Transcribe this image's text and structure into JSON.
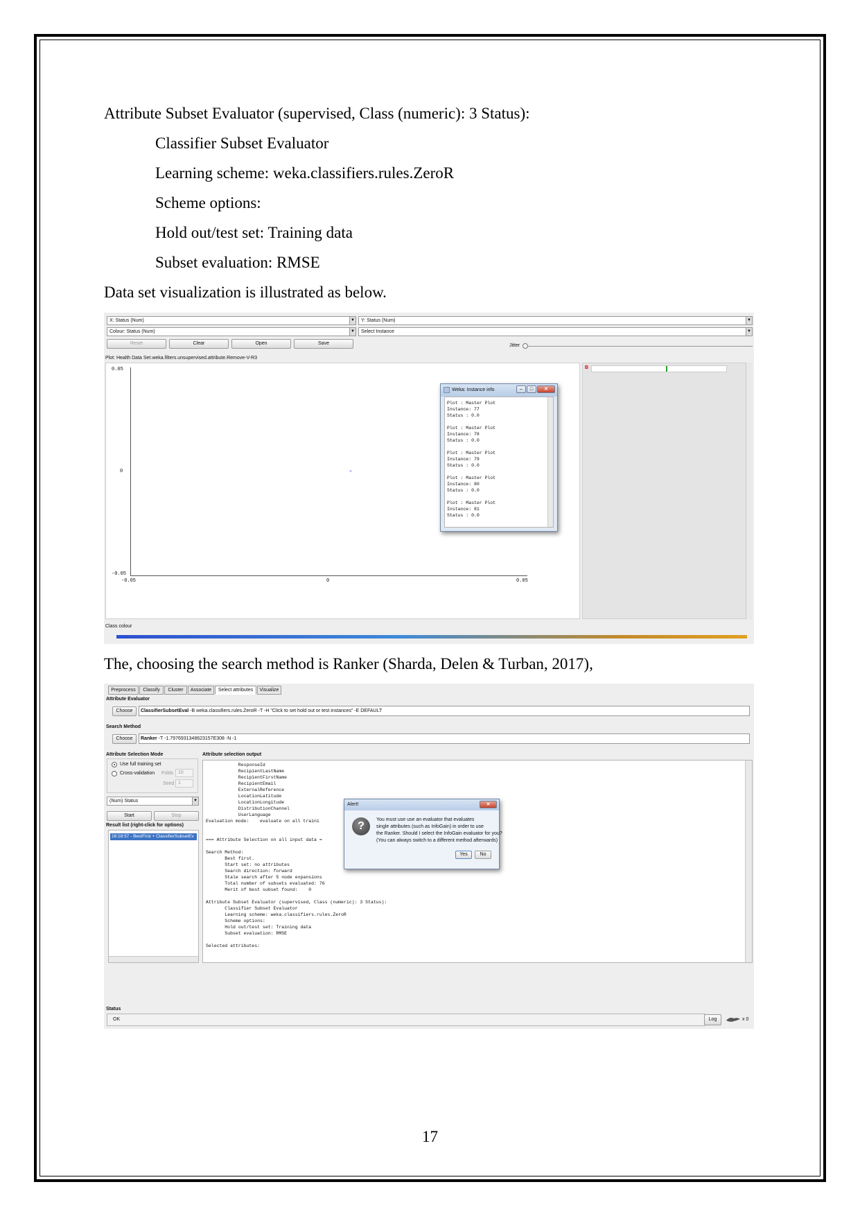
{
  "document": {
    "heading_line": "Attribute Subset Evaluator (supervised, Class (numeric): 3 Status):",
    "indented_lines": [
      "Classifier Subset Evaluator",
      "Learning scheme: weka.classifiers.rules.ZeroR",
      "Scheme options:",
      "Hold out/test set: Training data",
      "Subset evaluation: RMSE"
    ],
    "visualization_intro": "Data set visualization is illustrated as below.",
    "search_method_intro": "The, choosing the search method is Ranker (Sharda, Delen & Turban, 2017),",
    "page_number": "17"
  },
  "screenshot1": {
    "x_combo": "X: Status (Num)",
    "y_combo": "Y: Status (Num)",
    "colour_combo": "Colour: Status (Num)",
    "instance_combo": "Select Instance",
    "buttons": {
      "reset": "Reset",
      "clear": "Clear",
      "open": "Open",
      "save": "Save"
    },
    "jitter_label": "Jitter",
    "plot_title": "Plot: Health Data Set.weka.filters.unsupervised.attribute.Remove-V-R3",
    "y_ticks": {
      "top": "0.05",
      "mid": "0",
      "bottom": "-0.05"
    },
    "x_ticks": {
      "left": "-0.05",
      "mid": "0",
      "right": "0.05"
    },
    "class_colour_label": "Class colour",
    "side_letter": "B",
    "info_window": {
      "title": "Weka: Instance info",
      "text": "Plot : Master Plot\nInstance: 77\nStatus : 0.0\n\nPlot : Master Plot\nInstance: 78\nStatus : 0.0\n\nPlot : Master Plot\nInstance: 79\nStatus : 0.0\n\nPlot : Master Plot\nInstance: 80\nStatus : 0.0\n\nPlot : Master Plot\nInstance: 81\nStatus : 0.0"
    }
  },
  "screenshot2": {
    "tabs": [
      "Preprocess",
      "Classify",
      "Cluster",
      "Associate",
      "Select attributes",
      "Visualize"
    ],
    "attribute_evaluator_label": "Attribute Evaluator",
    "choose_label": "Choose",
    "evaluator_name": "ClassifierSubsetEval",
    "evaluator_options": "-B weka.classifiers.rules.ZeroR -T -H \"Click to set hold out or test instances\" -E DEFAULT",
    "search_method_label": "Search Method",
    "search_name": "Ranker",
    "search_options": "-T -1.7976931348623157E308 -N -1",
    "selection_mode_label": "Attribute Selection Mode",
    "use_full_training": "Use full training set",
    "cross_validation": "Cross-validation",
    "folds_label": "Folds",
    "folds_value": "10",
    "seed_label": "Seed",
    "seed_value": "1",
    "class_combo": "(Num) Status",
    "start_label": "Start",
    "stop_label": "Stop",
    "result_list_label": "Result list (right-click for options)",
    "result_item": "16:18:57 - BestFirst + ClassifierSubsetEv",
    "output_label": "Attribute selection output",
    "output_text": "            ResponseId\n            RecipientLastName\n            RecipientFirstName\n            RecipientEmail\n            ExternalReference\n            LocationLatitude\n            LocationLongitude\n            DistributionChannel\n            UserLanguage\nEvaluation mode:    evaluate on all traini\n\n\n=== Attribute Selection on all input data =\n\nSearch Method:\n       Best first.\n       Start set: no attributes\n       Search direction: forward\n       Stale search after 5 node expansions\n       Total number of subsets evaluated: 76\n       Merit of best subset found:    0\n\nAttribute Subset Evaluator (supervised, Class (numeric): 3 Status):\n       Classifier Subset Evaluator\n       Learning scheme: weka.classifiers.rules.ZeroR\n       Scheme options:\n       Hold out/test set: Training data\n       Subset evaluation: RMSE\n\nSelected attributes:",
    "alert": {
      "title": "Alert!",
      "message_lines": [
        "You must use use an evaluator that evaluates",
        "single attributes (such as InfoGain) in order to use",
        "the Ranker. Should I select the InfoGain evaluator for you?",
        "(You can always switch to a different method afterwards)"
      ],
      "yes_label": "Yes",
      "no_label": "No"
    },
    "status_label": "Status",
    "status_text": "OK",
    "log_label": "Log",
    "x_count": "x 0"
  }
}
